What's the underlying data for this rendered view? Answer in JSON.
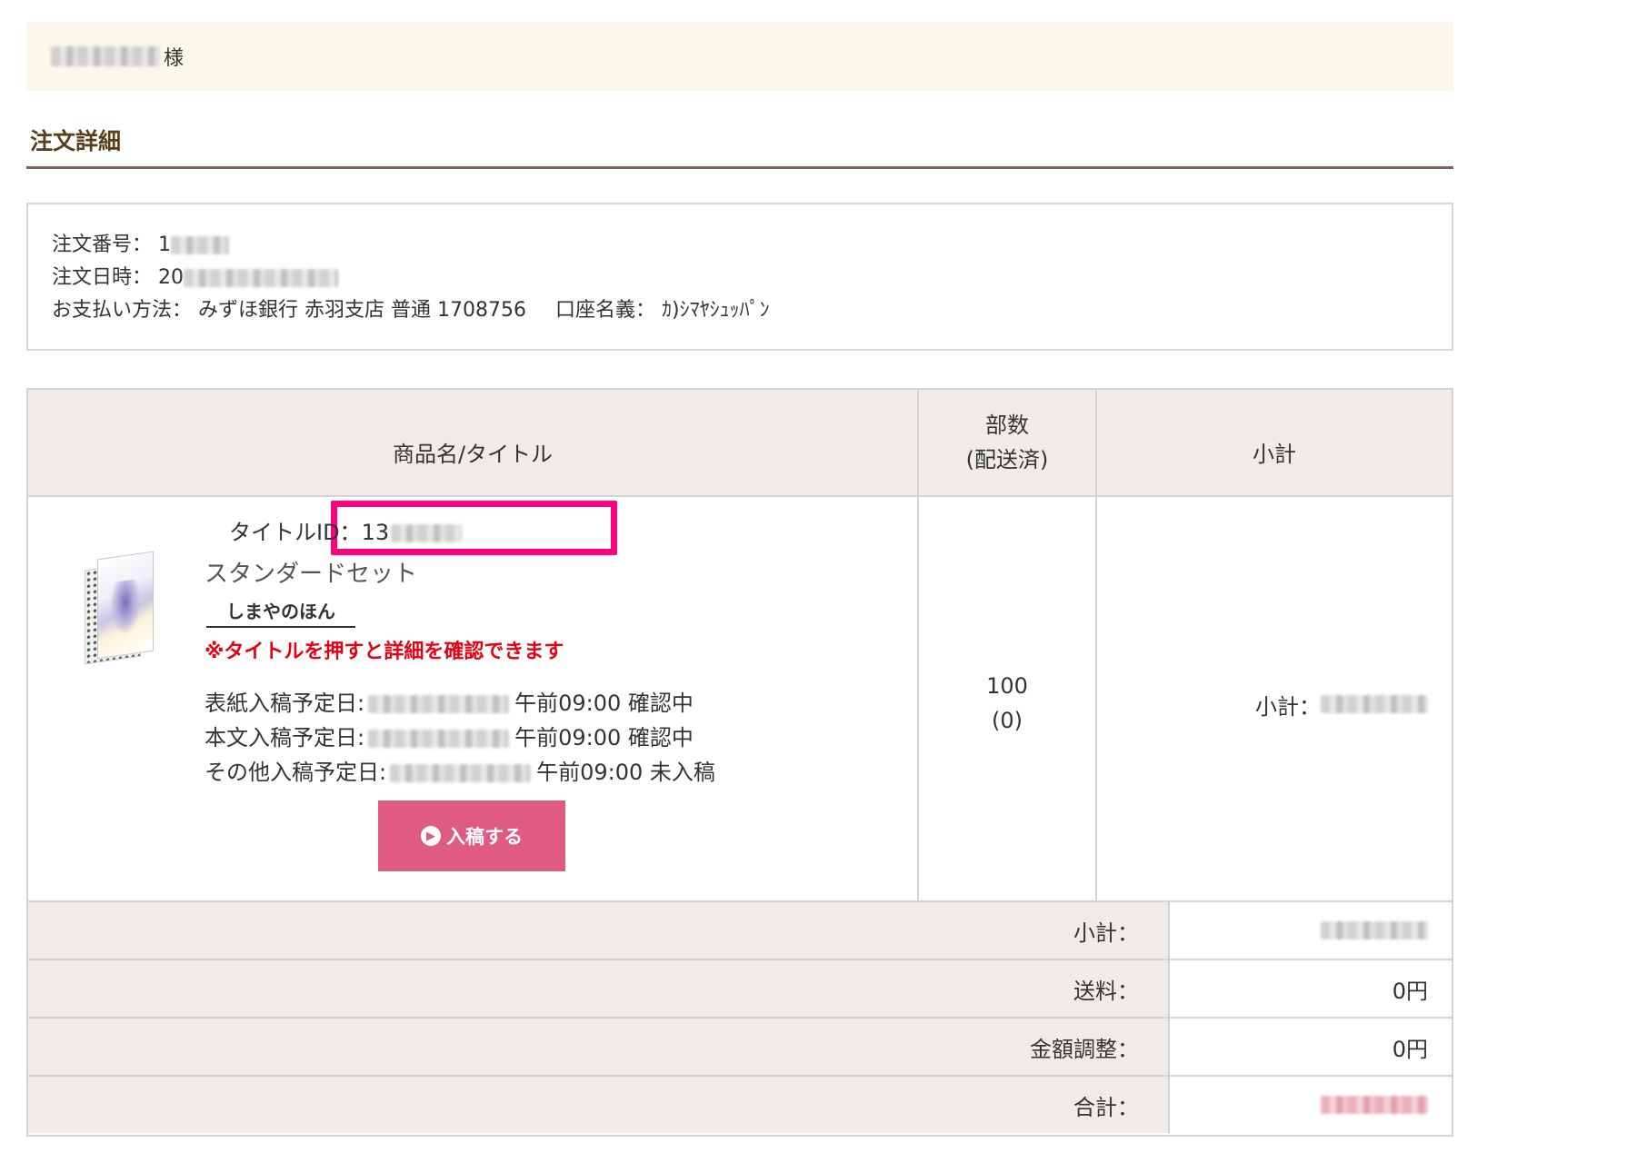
{
  "greeting": {
    "suffix": "様"
  },
  "section_title": "注文詳細",
  "order_info": {
    "order_number_label": "注文番号：",
    "order_number_visible": "1",
    "order_date_label": "注文日時：",
    "order_date_visible": "20",
    "payment_label": "お支払い方法：",
    "payment_value": "みずほ銀行 赤羽支店 普通 1708756",
    "account_label": "口座名義：",
    "account_value": "ｶ)ｼﾏﾔｼｭｯﾊﾟﾝ"
  },
  "table": {
    "headers": {
      "product": "商品名/タイトル",
      "quantity_line1": "部数",
      "quantity_line2": "(配送済)",
      "subtotal": "小計"
    },
    "item": {
      "title_id_label": "タイトルID：",
      "title_id_visible": "13",
      "set_name": "スタンダードセット",
      "shop_link": "しまやのほん",
      "note": "※タイトルを押すと詳細を確認できます",
      "dates": [
        {
          "label": "表紙入稿予定日:",
          "time": "午前09:00",
          "status": "確認中"
        },
        {
          "label": "本文入稿予定日:",
          "time": "午前09:00",
          "status": "確認中"
        },
        {
          "label": "その他入稿予定日:",
          "time": "午前09:00",
          "status": "未入稿"
        }
      ],
      "submit_button": "入稿する",
      "quantity": "100",
      "shipped": "(0)",
      "subtotal_label": "小計："
    },
    "summary": [
      {
        "label": "小計：",
        "value": null
      },
      {
        "label": "送料：",
        "value": "0円"
      },
      {
        "label": "金額調整：",
        "value": "0円"
      },
      {
        "label": "合計：",
        "value": null
      }
    ]
  },
  "colors": {
    "greeting_bg": "#fbf7ea",
    "heading_text": "#5a3e1b",
    "heading_rule": "#74645c",
    "table_header_bg": "#efebe6",
    "highlight_box": "#ff0080",
    "note_red": "#e60012",
    "button_pink": "#e05b84"
  }
}
